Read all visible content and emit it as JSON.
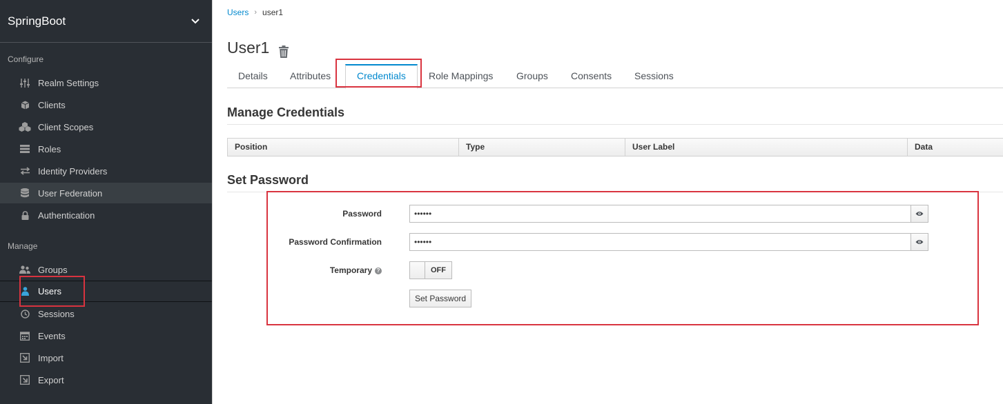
{
  "sidebar": {
    "realm_name": "SpringBoot",
    "configure_title": "Configure",
    "manage_title": "Manage",
    "configure_items": [
      {
        "label": "Realm Settings",
        "icon": "sliders-icon"
      },
      {
        "label": "Clients",
        "icon": "cube-icon"
      },
      {
        "label": "Client Scopes",
        "icon": "cubes-icon"
      },
      {
        "label": "Roles",
        "icon": "list-icon"
      },
      {
        "label": "Identity Providers",
        "icon": "exchange-icon"
      },
      {
        "label": "User Federation",
        "icon": "database-icon"
      },
      {
        "label": "Authentication",
        "icon": "lock-icon"
      }
    ],
    "manage_items": [
      {
        "label": "Groups",
        "icon": "users-icon"
      },
      {
        "label": "Users",
        "icon": "user-icon"
      },
      {
        "label": "Sessions",
        "icon": "clock-icon"
      },
      {
        "label": "Events",
        "icon": "calendar-icon"
      },
      {
        "label": "Import",
        "icon": "import-icon"
      },
      {
        "label": "Export",
        "icon": "export-icon"
      }
    ]
  },
  "breadcrumb": {
    "link": "Users",
    "current": "user1"
  },
  "page": {
    "title": "User1"
  },
  "tabs": [
    "Details",
    "Attributes",
    "Credentials",
    "Role Mappings",
    "Groups",
    "Consents",
    "Sessions"
  ],
  "active_tab": "Credentials",
  "manage_credentials": {
    "title": "Manage Credentials",
    "columns": [
      "Position",
      "Type",
      "User Label",
      "Data"
    ]
  },
  "set_password": {
    "title": "Set Password",
    "password_label": "Password",
    "password_value": "••••••",
    "confirm_label": "Password Confirmation",
    "confirm_value": "••••••",
    "temporary_label": "Temporary",
    "temporary_state": "OFF",
    "button_label": "Set Password"
  },
  "colors": {
    "sidebar_bg": "#292e34",
    "accent": "#0088ce",
    "annotation": "#d9333f"
  }
}
